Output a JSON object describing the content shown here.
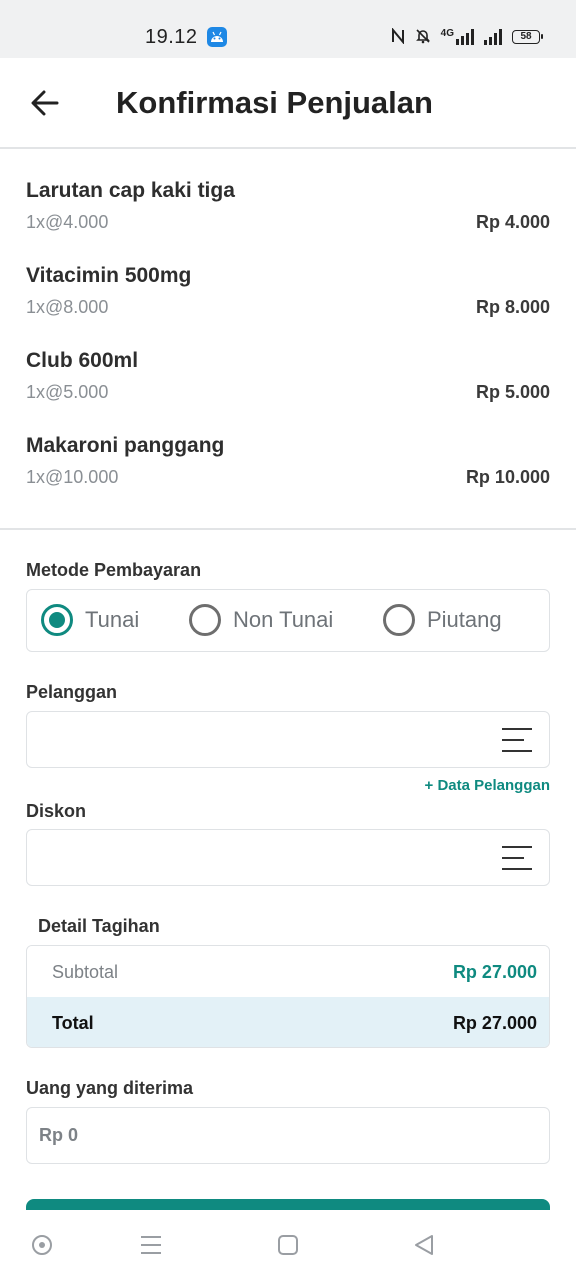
{
  "status_bar": {
    "time": "19.12",
    "network": "4G",
    "battery": "58"
  },
  "app_bar": {
    "title": "Konfirmasi Penjualan"
  },
  "items": [
    {
      "name": "Larutan cap kaki tiga",
      "qty": "1x@4.000",
      "total": "Rp 4.000"
    },
    {
      "name": "Vitacimin 500mg",
      "qty": "1x@8.000",
      "total": "Rp 8.000"
    },
    {
      "name": "Club 600ml",
      "qty": "1x@5.000",
      "total": "Rp 5.000"
    },
    {
      "name": "Makaroni panggang",
      "qty": "1x@10.000",
      "total": "Rp 10.000"
    }
  ],
  "payment": {
    "label": "Metode Pembayaran",
    "options": [
      "Tunai",
      "Non Tunai",
      "Piutang"
    ],
    "selected": "Tunai"
  },
  "customer": {
    "label": "Pelanggan",
    "value": "",
    "add_link": "+ Data Pelanggan"
  },
  "discount": {
    "label": "Diskon",
    "value": ""
  },
  "bill": {
    "title": "Detail Tagihan",
    "subtotal_label": "Subtotal",
    "subtotal_value": "Rp 27.000",
    "total_label": "Total",
    "total_value": "Rp 27.000"
  },
  "received": {
    "label": "Uang yang diterima",
    "placeholder": "Rp 0"
  },
  "colors": {
    "accent": "#0f8a80",
    "total_row_bg": "#e3f1f7",
    "status_bar_bg": "#f0f1f2"
  }
}
